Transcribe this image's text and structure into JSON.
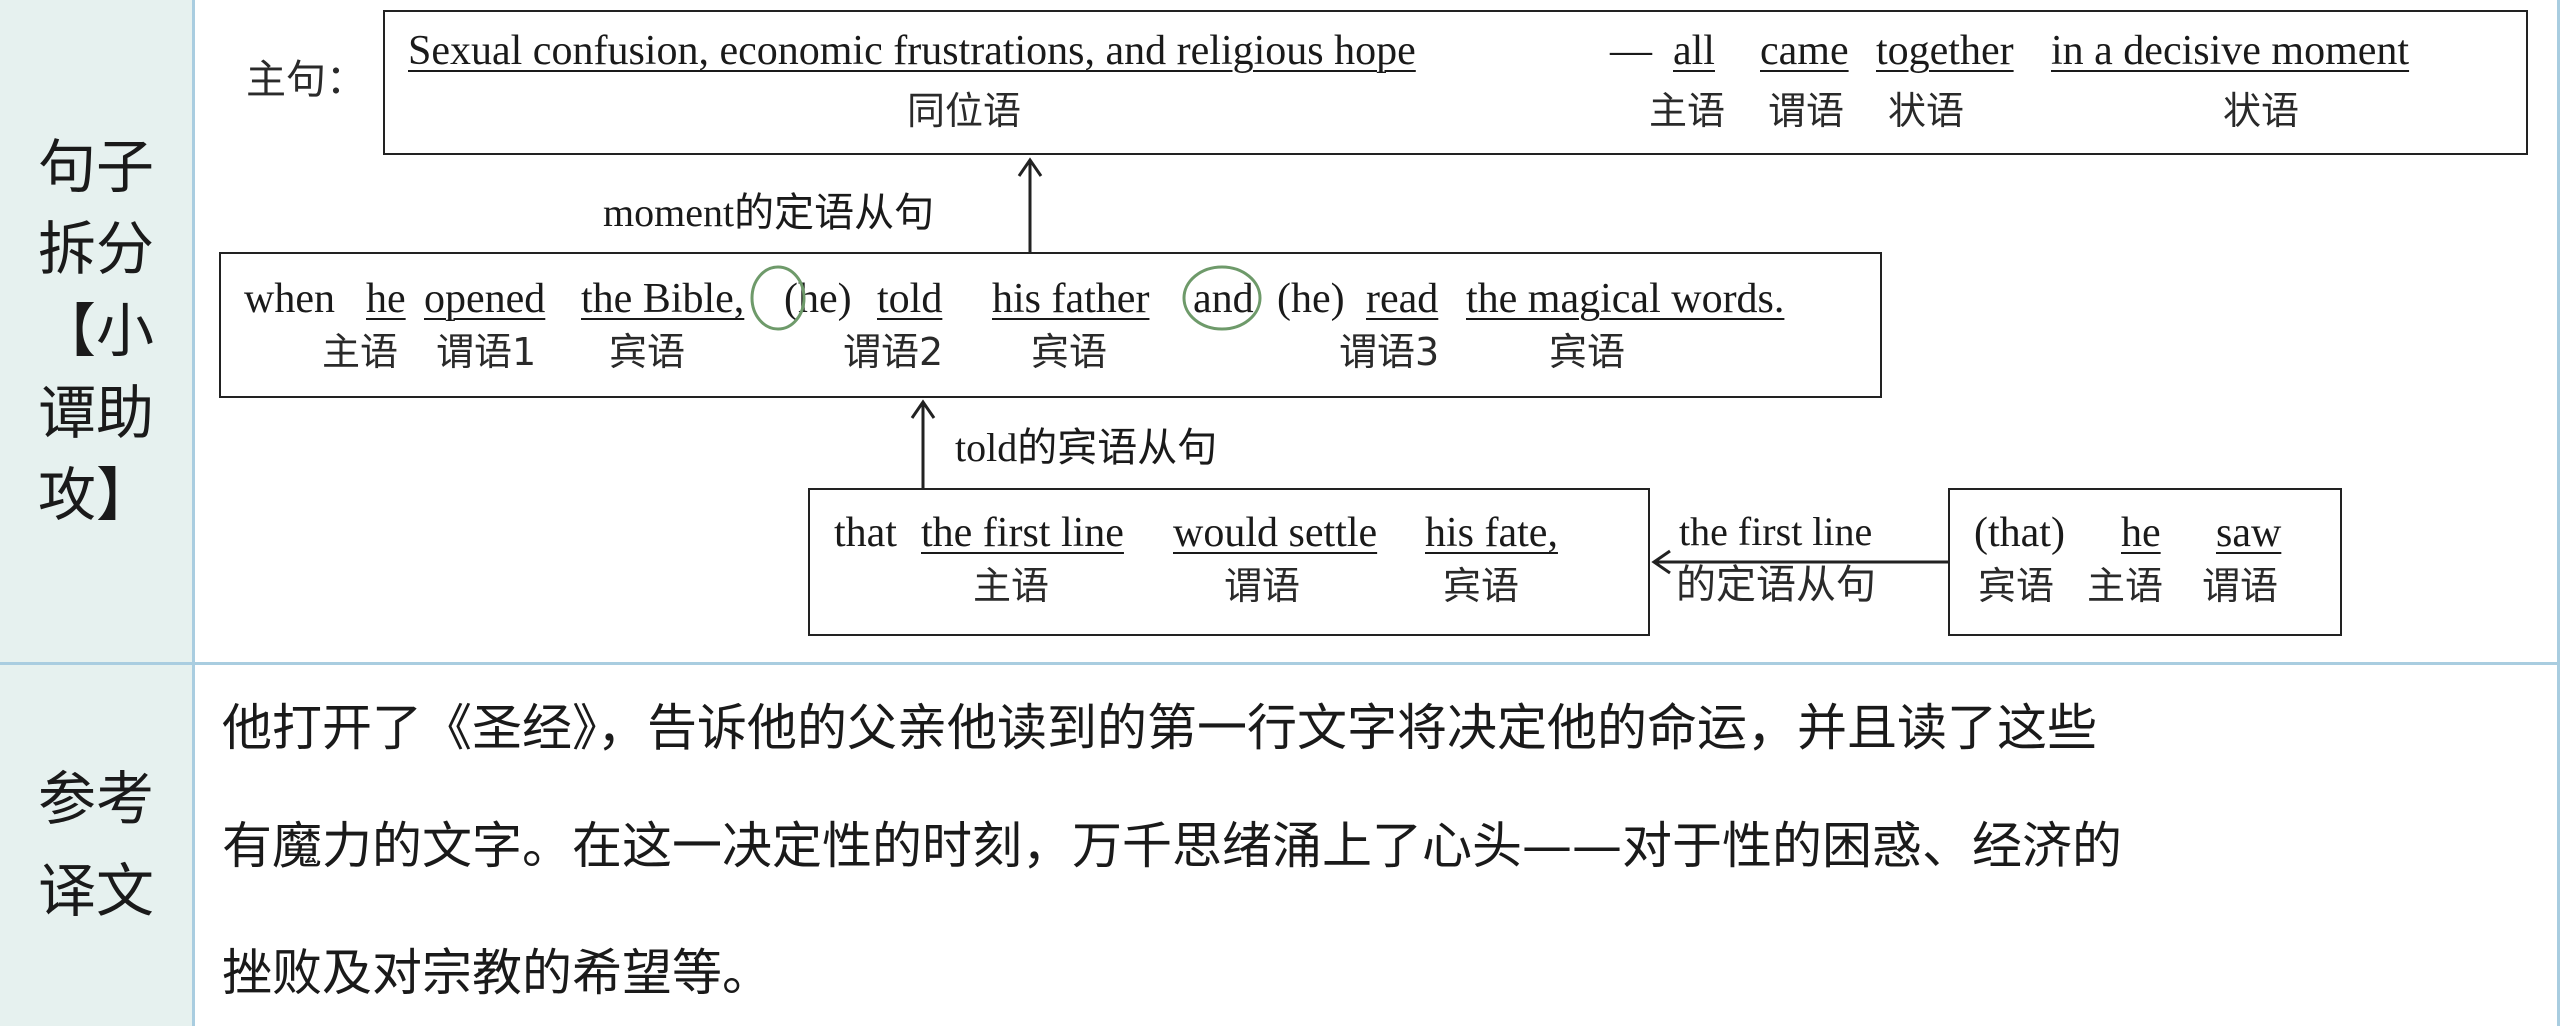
{
  "labels": {
    "breakdown": [
      "句子",
      "拆分",
      "【小",
      "谭助",
      "攻】"
    ],
    "translation": [
      "参考",
      "译文"
    ]
  },
  "main": {
    "prefix": "主句：",
    "words": [
      {
        "text": "Sexual confusion, economic frustrations, and religious hope",
        "role": "同位语"
      },
      {
        "text": "—",
        "role": ""
      },
      {
        "text": "all",
        "role": "主语"
      },
      {
        "text": "came",
        "role": "谓语"
      },
      {
        "text": "together",
        "role": "状语"
      },
      {
        "text": "in a decisive moment",
        "role": "状语"
      }
    ]
  },
  "when_clause": {
    "tag": "moment的定语从句",
    "words": [
      {
        "text": "when",
        "role": ""
      },
      {
        "text": "he",
        "role": "主语"
      },
      {
        "text": "opened",
        "role": "谓语1"
      },
      {
        "text": "the Bible,",
        "role": "宾语"
      },
      {
        "text": "(he)",
        "role": ""
      },
      {
        "text": "told",
        "role": "谓语2"
      },
      {
        "text": "his father",
        "role": "宾语"
      },
      {
        "text": "and",
        "role": ""
      },
      {
        "text": "(he)",
        "role": ""
      },
      {
        "text": "read",
        "role": "谓语3"
      },
      {
        "text": "the magical words.",
        "role": "宾语"
      }
    ]
  },
  "that_clause": {
    "tag": "told的宾语从句",
    "words": [
      {
        "text": "that",
        "role": ""
      },
      {
        "text": "the first line",
        "role": "主语"
      },
      {
        "text": "would settle",
        "role": "谓语"
      },
      {
        "text": "his fate,",
        "role": "宾语"
      }
    ]
  },
  "relative_clause": {
    "tag_line1": "the first line",
    "tag_line2": "的定语从句",
    "words": [
      {
        "text": "(that)",
        "role": "宾语"
      },
      {
        "text": "he",
        "role": "主语"
      },
      {
        "text": "saw",
        "role": "谓语"
      }
    ]
  },
  "translation_lines": [
    "他打开了《圣经》，告诉他的父亲他读到的第一行文字将决定他的命运，并且读了这些",
    "有魔力的文字。在这一决定性的时刻，万千思绪涌上了心头——对于性的困惑、经济的",
    "挫败及对宗教的希望等。"
  ],
  "colors": {
    "label_bg": "#e6f1ef",
    "grid": "#a9cde0",
    "circle": "#6e9a6a"
  }
}
